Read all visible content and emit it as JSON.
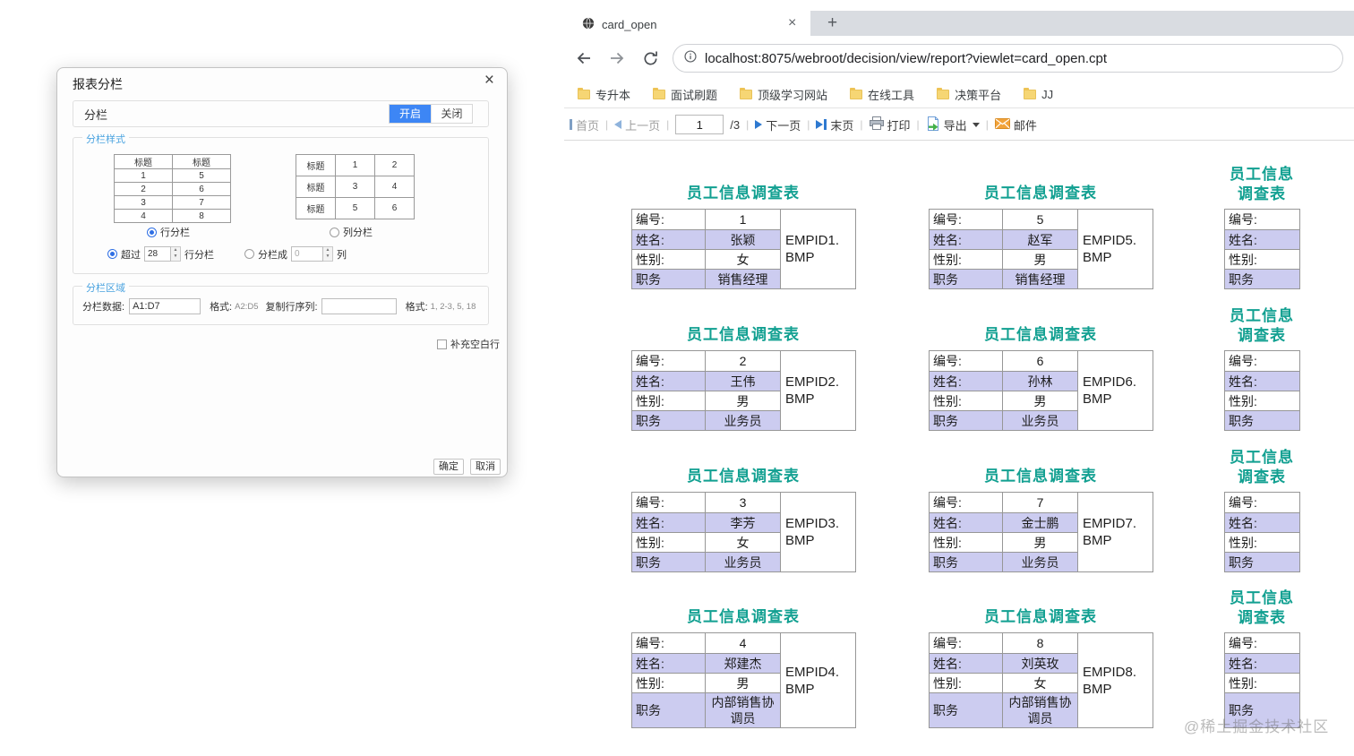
{
  "dialog": {
    "title": "报表分栏",
    "close": "×",
    "split": {
      "label": "分栏",
      "on": "开启",
      "off": "关闭"
    },
    "style": {
      "section_label": "分栏样式",
      "row_table": {
        "headers": [
          "标题",
          "标题"
        ],
        "rows": [
          [
            "1",
            "5"
          ],
          [
            "2",
            "6"
          ],
          [
            "3",
            "7"
          ],
          [
            "4",
            "8"
          ]
        ]
      },
      "col_table": {
        "rows": [
          [
            "标题",
            "1",
            "2"
          ],
          [
            "标题",
            "3",
            "4"
          ],
          [
            "标题",
            "5",
            "6"
          ]
        ]
      },
      "row_radio": "行分栏",
      "col_radio": "列分栏",
      "over": {
        "prefix": "超过",
        "value": "28",
        "suffix": "行分栏"
      },
      "into": {
        "prefix": "分栏成",
        "value": "0",
        "suffix": "列"
      }
    },
    "area": {
      "section_label": "分栏区域",
      "data_label": "分栏数据:",
      "data_value": "A1:D7",
      "format1_label": "格式:",
      "format1_value": "A2:D5",
      "copy_label": "复制行序列:",
      "copy_value": "",
      "format2_label": "格式:",
      "format2_value": "1, 2-3, 5, 18"
    },
    "fill_blank": "补充空白行",
    "ok": "确定",
    "cancel": "取消"
  },
  "browser": {
    "tab": {
      "title": "card_open",
      "close": "×",
      "new_tab": "+"
    },
    "url": "localhost:8075/webroot/decision/view/report?viewlet=card_open.cpt",
    "bookmarks": [
      "专升本",
      "面试刷题",
      "顶级学习网站",
      "在线工具",
      "决策平台",
      "JJ"
    ],
    "toolbar": {
      "first": "首页",
      "prev": "上一页",
      "page": "1",
      "total": "/3",
      "next": "下一页",
      "last": "末页",
      "print": "打印",
      "export": "导出",
      "mail": "邮件"
    },
    "report": {
      "card_title": "员工信息调查表",
      "row_labels": [
        "编号:",
        "姓名:",
        "性别:",
        "职务"
      ],
      "cards": [
        {
          "no": "1",
          "name": "张颖",
          "gender": "女",
          "position": "销售经理",
          "image": "EMPID1.BMP"
        },
        {
          "no": "2",
          "name": "王伟",
          "gender": "男",
          "position": "业务员",
          "image": "EMPID2.BMP"
        },
        {
          "no": "3",
          "name": "李芳",
          "gender": "女",
          "position": "业务员",
          "image": "EMPID3.BMP"
        },
        {
          "no": "4",
          "name": "郑建杰",
          "gender": "男",
          "position": "内部销售协调员",
          "image": "EMPID4.BMP"
        },
        {
          "no": "5",
          "name": "赵军",
          "gender": "男",
          "position": "销售经理",
          "image": "EMPID5.BMP"
        },
        {
          "no": "6",
          "name": "孙林",
          "gender": "男",
          "position": "业务员",
          "image": "EMPID6.BMP"
        },
        {
          "no": "7",
          "name": "金士鹏",
          "gender": "男",
          "position": "业务员",
          "image": "EMPID7.BMP"
        },
        {
          "no": "8",
          "name": "刘英玫",
          "gender": "女",
          "position": "内部销售协调员",
          "image": "EMPID8.BMP"
        }
      ]
    }
  },
  "watermark": "@稀土掘金技术社区",
  "colors": {
    "card_title": "#12a091",
    "row_highlight": "#ccccf0",
    "toggle_on": "#3d86f5",
    "link_blue": "#2e79d0"
  }
}
